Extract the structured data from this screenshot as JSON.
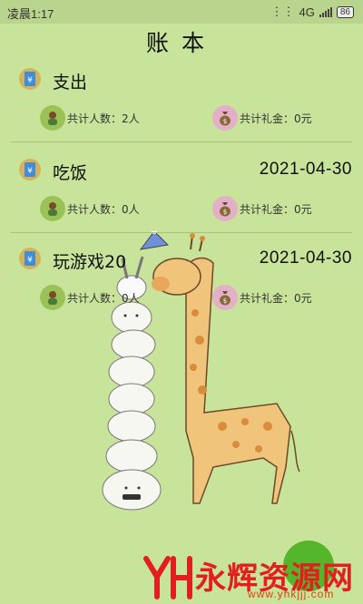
{
  "status_bar": {
    "time": "凌晨1:17",
    "network": "4G",
    "battery": "86"
  },
  "page": {
    "title": "账本"
  },
  "ledgers": [
    {
      "name": "支出",
      "date": "",
      "people_label": "共计人数：2人",
      "gift_label": "共计礼金：0元"
    },
    {
      "name": "吃饭",
      "date": "2021-04-30",
      "people_label": "共计人数：0人",
      "gift_label": "共计礼金：0元"
    },
    {
      "name": "玩游戏20",
      "date": "2021-04-30",
      "people_label": "共计人数：0人",
      "gift_label": "共计礼金：0元"
    }
  ],
  "icons": {
    "book": "ledger-book-icon",
    "person": "person-avatar-icon",
    "money": "money-bag-icon"
  },
  "colors": {
    "background": "#c8e39a",
    "fab": "#55b52b",
    "watermark": "#e21e1e"
  },
  "watermark": {
    "logo": "YH",
    "text": "永辉资源网",
    "url": "www.yhkjjj.com"
  }
}
